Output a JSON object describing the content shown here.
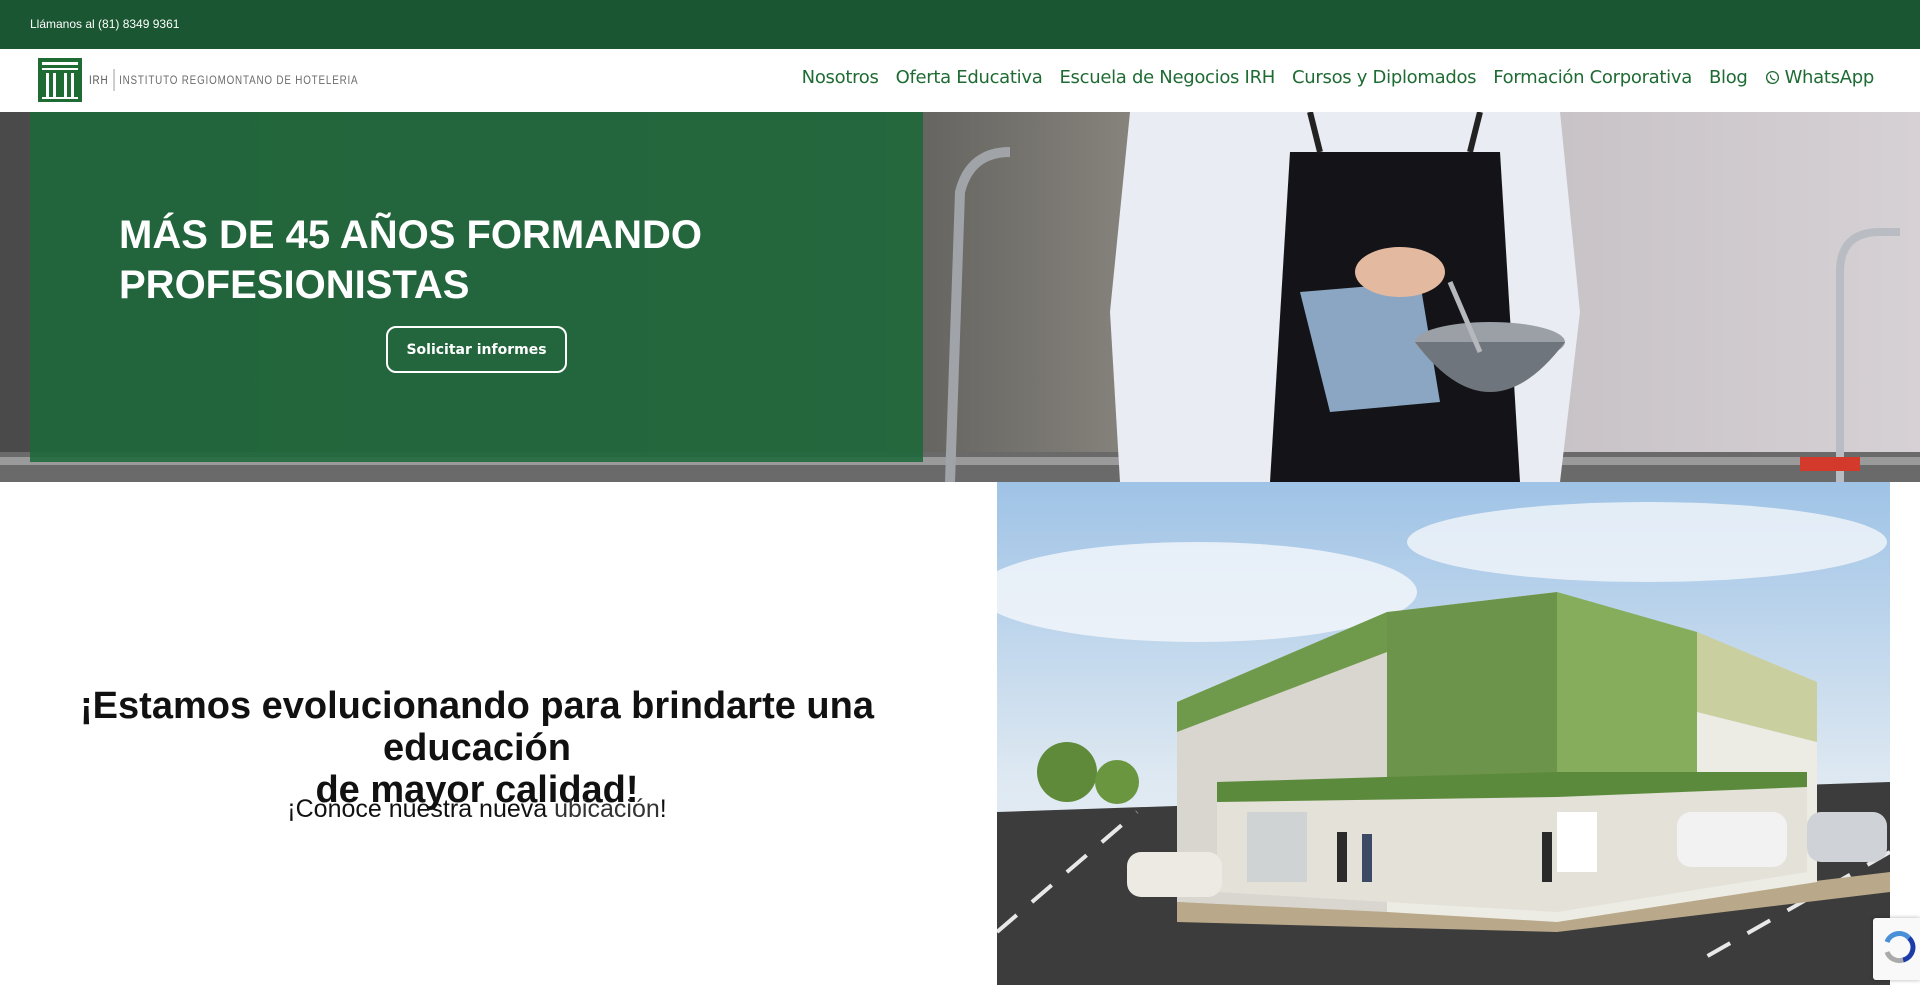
{
  "topbar": {
    "phone_text": "Llámanos al (81) 8349 9361"
  },
  "header": {
    "logo": {
      "abbr": "IRH",
      "name": "INSTITUTO REGIOMONTANO DE HOTELERIA",
      "icon": "irh-logo-icon"
    },
    "nav": [
      {
        "label": "Nosotros"
      },
      {
        "label": "Oferta Educativa"
      },
      {
        "label": "Escuela de Negocios IRH"
      },
      {
        "label": "Cursos y Diplomados"
      },
      {
        "label": "Formación Corporativa"
      },
      {
        "label": "Blog"
      },
      {
        "label": "WhatsApp",
        "icon": "whatsapp-icon"
      }
    ]
  },
  "hero": {
    "title": "MÁS DE 45 AÑOS FORMANDO PROFESIONISTAS",
    "button_label": "Solicitar informes"
  },
  "promo": {
    "heading_prefix": "¡Estamos evolucionando para brindarte una ",
    "heading_bold": "educación",
    "heading_suffix": " de mayor calidad!",
    "sub_prefix": "¡Conoce nuestra nueva ",
    "sub_link": "ubicación",
    "sub_suffix": "!"
  },
  "colors": {
    "brand_green": "#1a5631",
    "overlay_green": "#1c693a",
    "nav_green": "#1f6b34"
  }
}
